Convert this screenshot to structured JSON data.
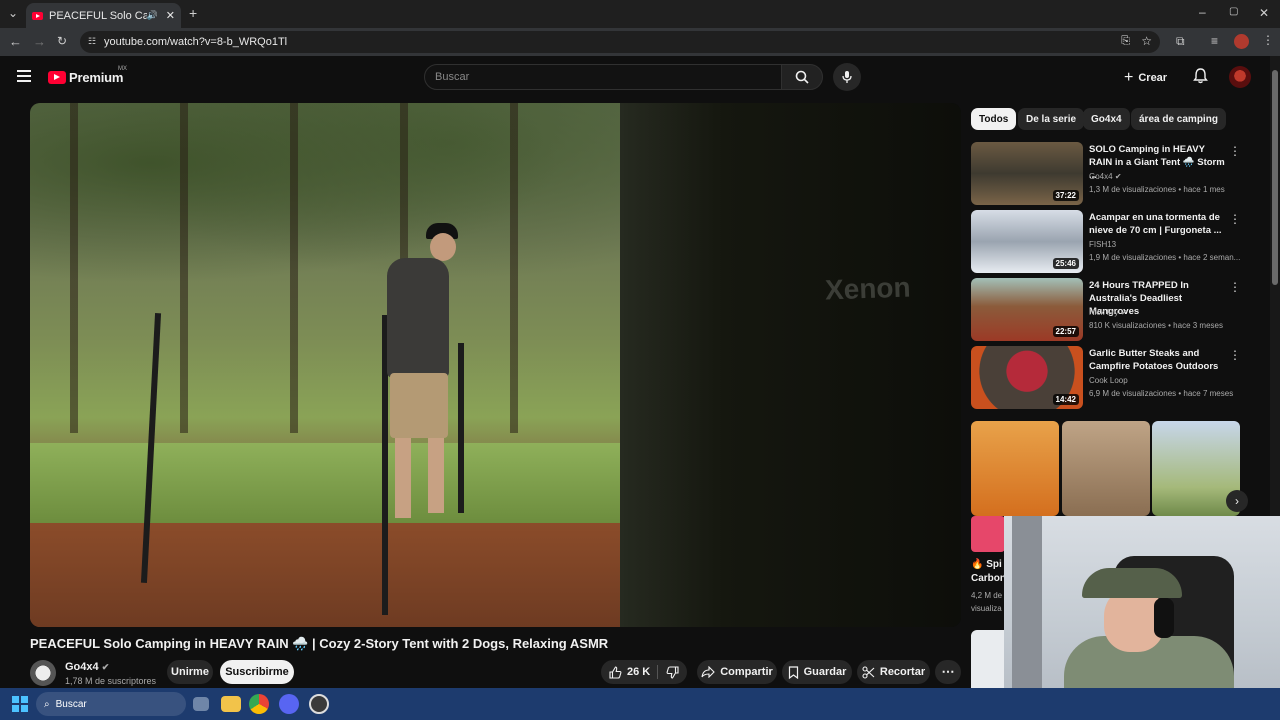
{
  "browser": {
    "tab_title": "PEACEFUL Solo Camping in",
    "url": "youtube.com/watch?v=8-b_WRQo1Tl"
  },
  "header": {
    "logo_text": "Premium",
    "logo_region": "MX",
    "search_placeholder": "Buscar",
    "create_label": "Crear"
  },
  "video": {
    "title": "PEACEFUL Solo Camping in HEAVY RAIN 🌧️ | Cozy 2-Story Tent with 2 Dogs, Relaxing ASMR",
    "channel": "Go4x4",
    "subscribers": "1,78 M de suscriptores",
    "join_label": "Unirme",
    "subscribe_label": "Suscribirme",
    "likes": "26 K",
    "share_label": "Compartir",
    "save_label": "Guardar",
    "clip_label": "Recortar",
    "tent_brand": "Xenon"
  },
  "sidebar": {
    "chips": [
      "Todos",
      "De la serie",
      "Go4x4",
      "área de camping"
    ],
    "recommendations": [
      {
        "title": "SOLO Camping in HEAVY RAIN in a Giant Tent 🌧️ Storm ...",
        "channel": "Go4x4",
        "verified": true,
        "meta": "1,3 M de visualizaciones • hace 1 mes",
        "duration": "37:22"
      },
      {
        "title": "Acampar en una tormenta de nieve de 70 cm | Furgoneta ...",
        "channel": "FISH13",
        "verified": false,
        "meta": "1,9 M de visualizaciones • hace 2 seman...",
        "duration": "25:46"
      },
      {
        "title": "24 Hours TRAPPED In Australia's Deadliest Mangroves",
        "channel": "Nick Fry",
        "verified": true,
        "meta": "810 K visualizaciones • hace 3 meses",
        "duration": "22:57"
      },
      {
        "title": "Garlic Butter Steaks and Campfire Potatoes Outdoors",
        "channel": "Cook Loop",
        "verified": false,
        "meta": "6,9 M de visualizaciones • hace 7 meses",
        "duration": "14:42"
      }
    ],
    "short_partial": {
      "title_line1": "🔥 Spi",
      "title_line2": "Carbon",
      "meta_line1": "4,2 M de",
      "meta_line2": "visualiza"
    }
  },
  "taskbar": {
    "search_label": "Buscar"
  },
  "colors": {
    "brand_red": "#ff0033",
    "background": "#0f0f0f",
    "taskbar": "#1d3b6e"
  }
}
